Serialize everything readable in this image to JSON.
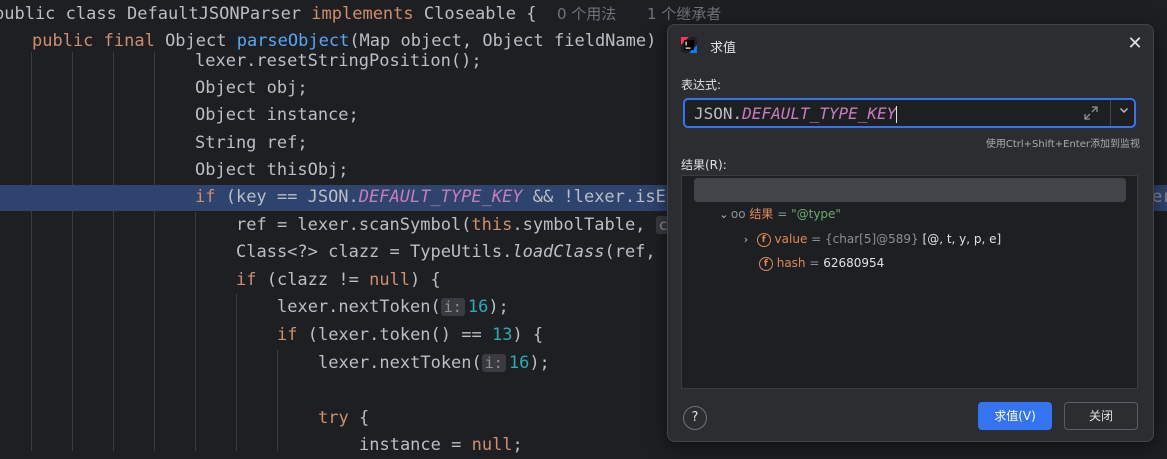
{
  "code": {
    "class_line": {
      "prefix": "public class DefaultJSONParser ",
      "implements": "implements",
      "iface": " Closeable {",
      "usages": "0 个用法",
      "inheritors": "1 个继承者"
    },
    "method_line": {
      "mods": "public final",
      "rtype": " Object ",
      "name": "parseObject",
      "args": "(Map object, Object fieldName) {"
    },
    "lines": [
      "lexer.resetStringPosition();",
      "Object obj;",
      "Object instance;",
      "String ref;",
      "Object thisObj;"
    ],
    "if_line": {
      "kw": "if",
      "pre": " (key == JSON.",
      "const": "DEFAULT_TYPE_KEY",
      "post": " && !lexer.isEn"
    },
    "ref_line": {
      "pre": "ref = lexer.scanSymbol(",
      "this": "this",
      "post": ".symbolTable, ",
      "hint": "c"
    },
    "clazz_line": {
      "pre": "Class<?> clazz = TypeUtils.",
      "method": "loadClass",
      "post": "(ref, t"
    },
    "if_null": {
      "kw": "if",
      "pre": " (clazz != ",
      "null": "null",
      "post": ") {"
    },
    "next1": {
      "pre": "lexer.nextToken(",
      "hint": "i:",
      "num": "16",
      "post": ");"
    },
    "if_tok": {
      "kw": "if",
      "pre": " (lexer.token() == ",
      "num": "13",
      "post": ") {"
    },
    "next2": {
      "pre": "lexer.nextToken(",
      "hint": "i:",
      "num": "16",
      "post": ");"
    },
    "try_line": {
      "kw": "try",
      "post": " {"
    },
    "inst_line": {
      "pre": "instance = ",
      "null": "null",
      "post": ";"
    },
    "right_clip": "er"
  },
  "dialog": {
    "title": "求值",
    "expr_label": "表达式:",
    "expr_prefix": "JSON.",
    "expr_const": "DEFAULT_TYPE_KEY",
    "hint": "使用Ctrl+Shift+Enter添加到监视",
    "result_label": "结果(R):",
    "result_name": "结果",
    "result_value": "\"@type\"",
    "child1": {
      "name": "value",
      "type": "{char[5]@589}",
      "value": "[@, t, y, p, e]"
    },
    "child2": {
      "name": "hash",
      "value": "62680954"
    },
    "help": "?",
    "evaluate_button": "求值(V)",
    "close_button": "关闭",
    "accent": "#3574f0"
  }
}
